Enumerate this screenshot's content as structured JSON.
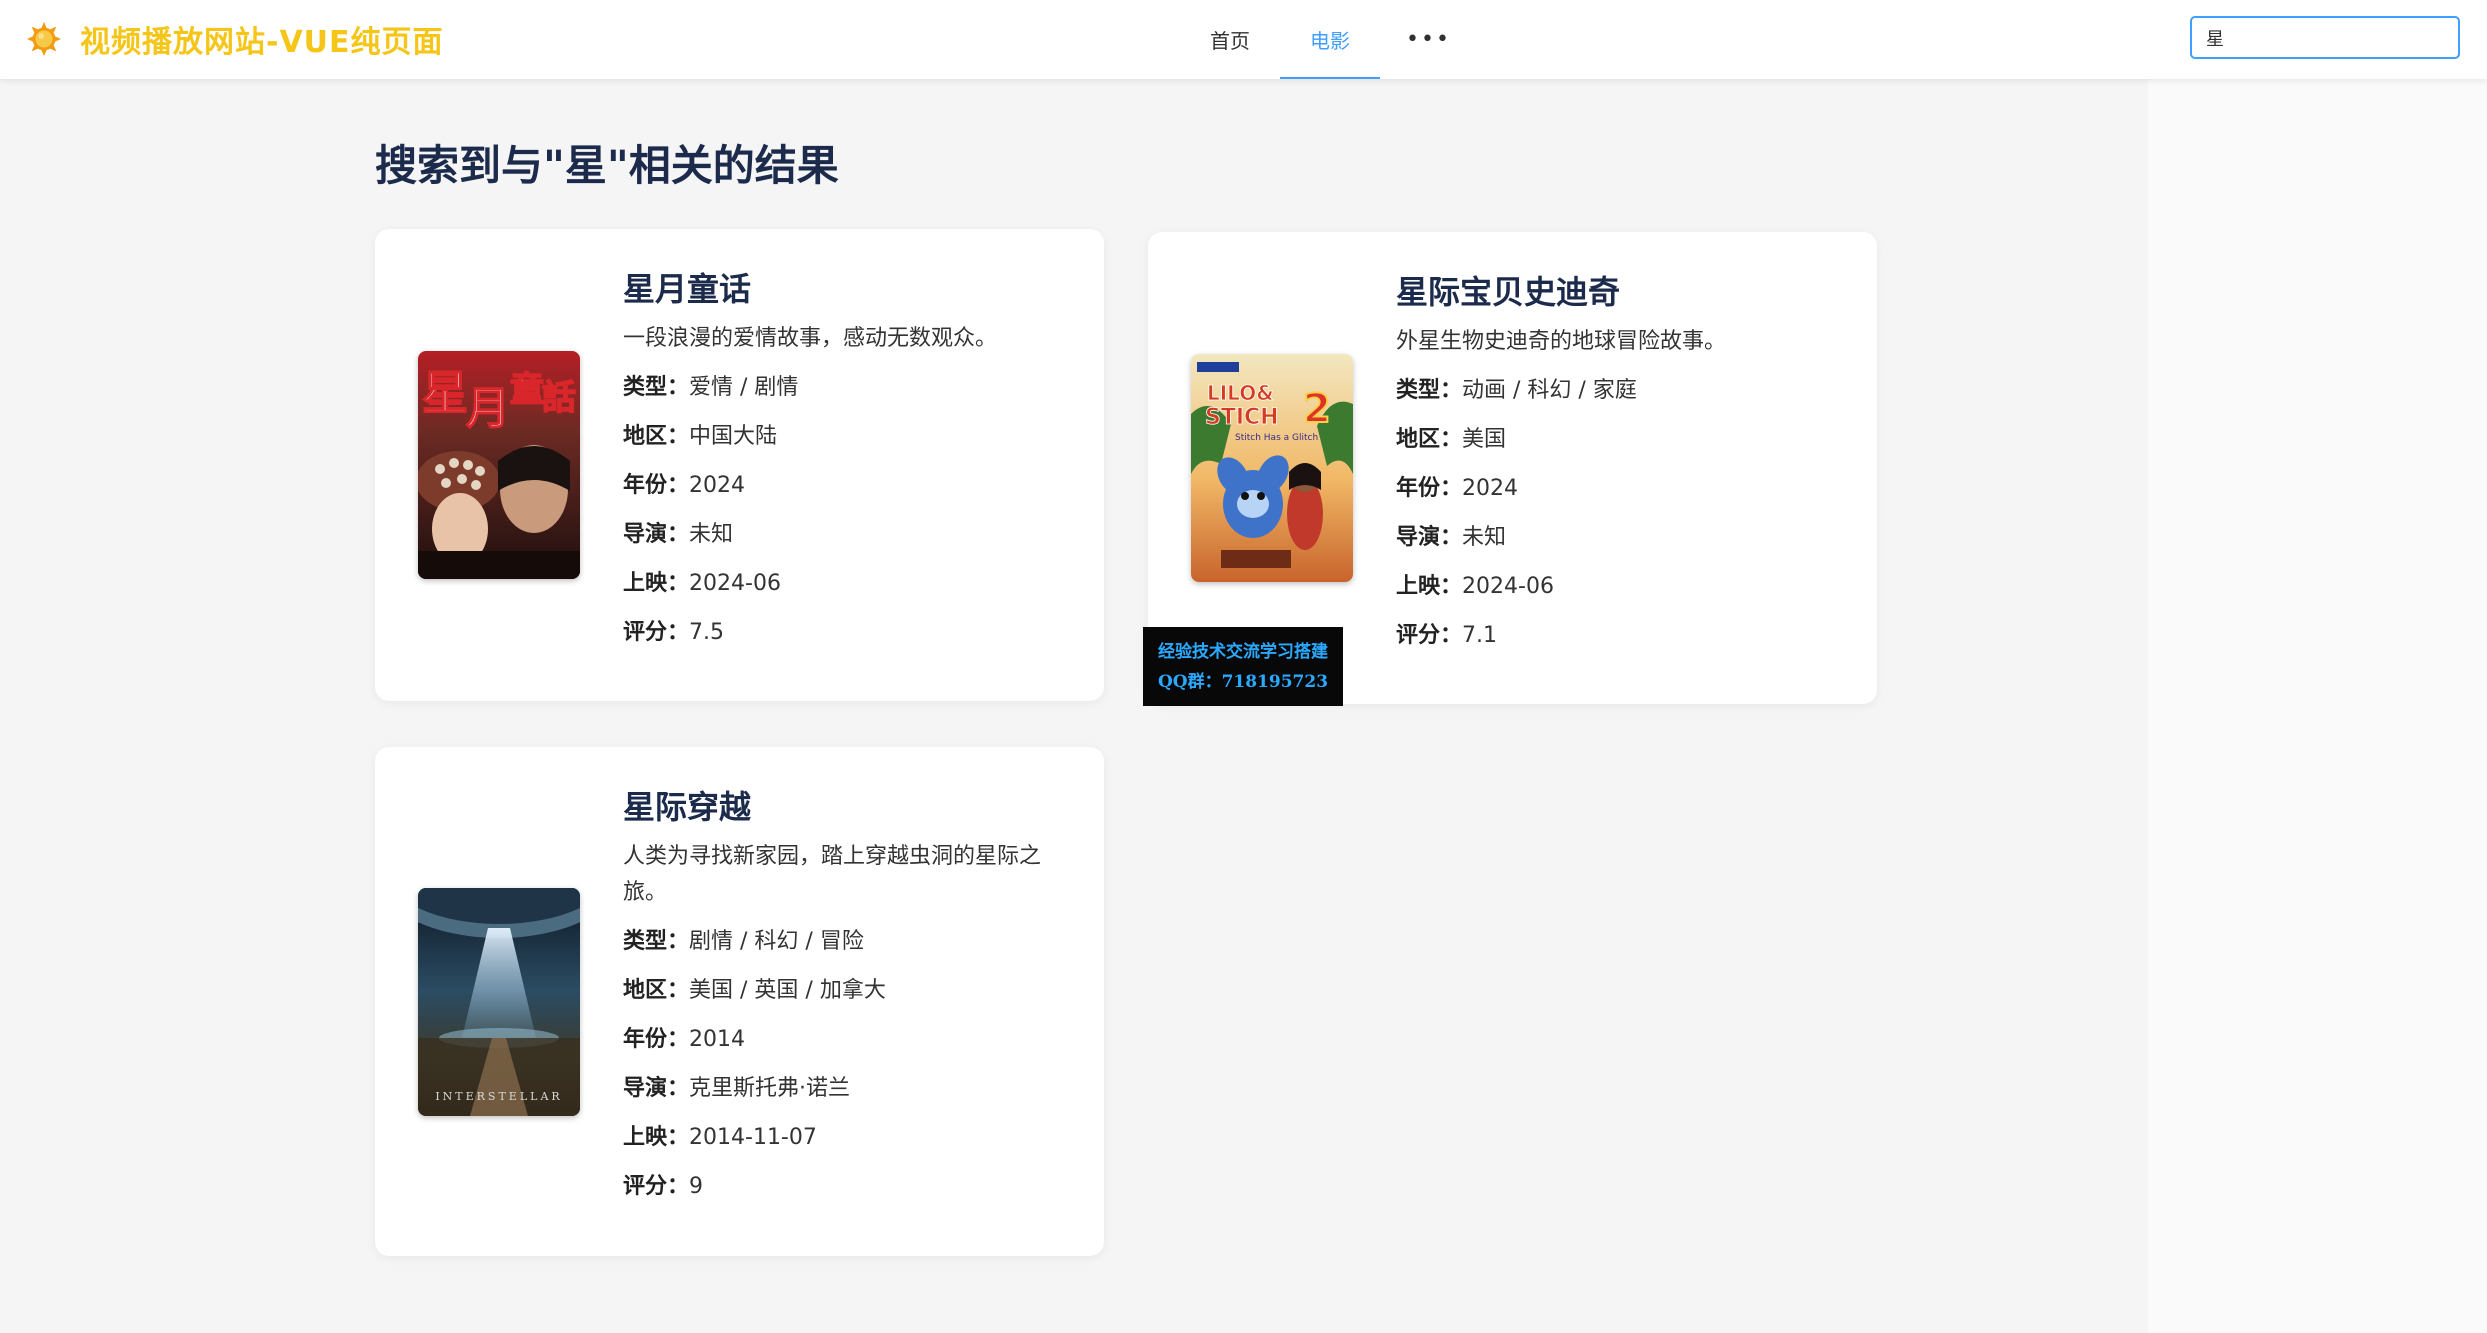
{
  "header": {
    "logo_icon": "sun-gear-logo",
    "site_title": "视频播放网站-VUE纯页面",
    "nav": [
      {
        "label": "首页",
        "active": false
      },
      {
        "label": "电影",
        "active": true
      },
      {
        "label": "•••",
        "icon": "more-horizontal-icon",
        "active": false
      }
    ],
    "search": {
      "value": "星",
      "placeholder": ""
    }
  },
  "main": {
    "title": "搜索到与\"星\"相关的结果",
    "movies": [
      {
        "title": "星月童话",
        "desc": "一段浪漫的爱情故事，感动无数观众。",
        "type_label": "类型：",
        "type": "爱情 / 剧情",
        "region_label": "地区：",
        "region": "中国大陆",
        "year_label": "年份：",
        "year": "2024",
        "director_label": "导演：",
        "director": "未知",
        "release_label": "上映：",
        "release": "2024-06",
        "rating_label": "评分：",
        "rating": "7.5",
        "poster_text": "星月童話"
      },
      {
        "title": "星际宝贝史迪奇",
        "desc": "外星生物史迪奇的地球冒险故事。",
        "type_label": "类型：",
        "type": "动画 / 科幻 / 家庭",
        "region_label": "地区：",
        "region": "美国",
        "year_label": "年份：",
        "year": "2024",
        "director_label": "导演：",
        "director": "未知",
        "release_label": "上映：",
        "release": "2024-06",
        "rating_label": "评分：",
        "rating": "7.1",
        "poster_text": "LILO & STITCH 2"
      },
      {
        "title": "星际穿越",
        "desc": "人类为寻找新家园，踏上穿越虫洞的星际之旅。",
        "type_label": "类型：",
        "type": "剧情 / 科幻 / 冒险",
        "region_label": "地区：",
        "region": "美国 / 英国 / 加拿大",
        "year_label": "年份：",
        "year": "2014",
        "director_label": "导演：",
        "director": "克里斯托弗·诺兰",
        "release_label": "上映：",
        "release": "2014-11-07",
        "rating_label": "评分：",
        "rating": "9",
        "poster_text": "INTERSTELLAR"
      }
    ]
  },
  "watermark": {
    "line1": "经验技术交流学习搭建",
    "line2": "QQ群：718195723"
  },
  "colors": {
    "accent": "#409eff",
    "logo": "#f5c518",
    "title": "#1c2b4b",
    "background": "#f5f5f5"
  }
}
